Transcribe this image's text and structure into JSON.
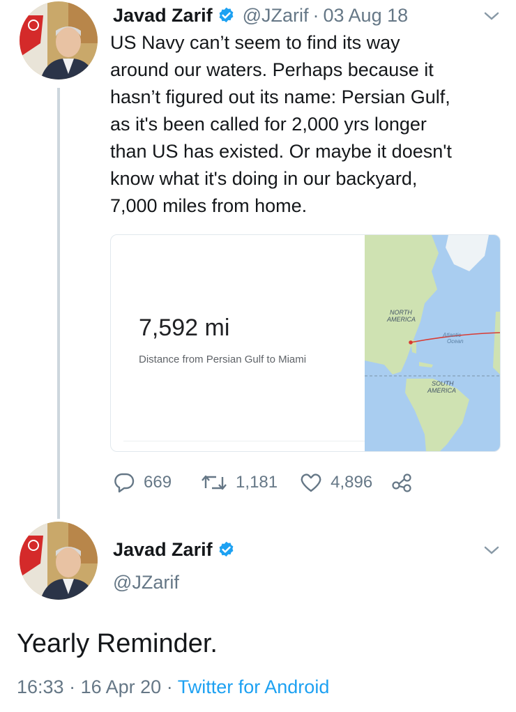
{
  "tweet1": {
    "display_name": "Javad Zarif",
    "handle": "@JZarif",
    "separator": "·",
    "date": "03 Aug 18",
    "text": "US Navy can’t seem to find its way\naround our waters. Perhaps because it\nhasn’t figured out its name: Persian Gulf,\nas it's been called for 2,000 yrs longer\nthan US has existed. Or maybe it doesn't\nknow what it's doing in our backyard,\n7,000 miles from home.",
    "card": {
      "distance": "7,592 mi",
      "description": "Distance from Persian Gulf to Miami",
      "map_labels": {
        "north_america_1": "NORTH",
        "north_america_2": "AMERICA",
        "ocean_1": "Atlantic",
        "ocean_2": "Ocean",
        "south_america_1": "SOUTH",
        "south_america_2": "AMERICA"
      }
    },
    "actions": {
      "replies": "669",
      "retweets": "1,181",
      "likes": "4,896"
    }
  },
  "tweet2": {
    "display_name": "Javad Zarif",
    "handle": "@JZarif",
    "text": "Yearly Reminder.",
    "time": "16:33",
    "separator": "·",
    "date": "16 Apr 20",
    "source": "Twitter for Android"
  },
  "colors": {
    "accent": "#1da1f2",
    "secondary_text": "#657786",
    "thread_line": "#cdd6dd",
    "map_water": "#a9cdf0",
    "map_land": "#cfe2b2",
    "route": "#d93a32"
  },
  "icons": {
    "verified": "verified-badge-icon",
    "chevron": "chevron-down-icon",
    "reply": "reply-icon",
    "retweet": "retweet-icon",
    "like": "heart-icon",
    "share": "share-icon"
  }
}
